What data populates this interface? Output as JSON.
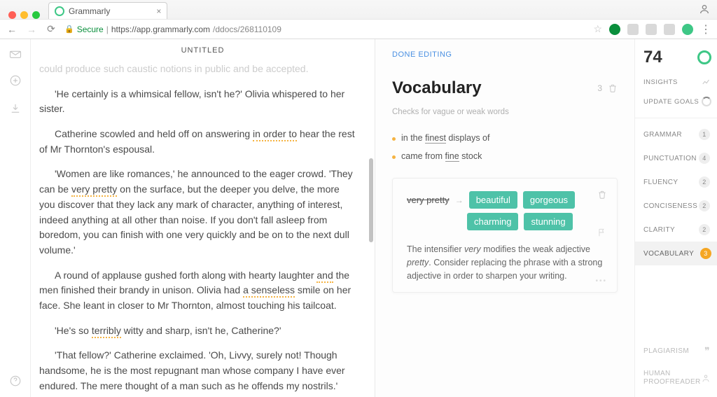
{
  "browser": {
    "tab_title": "Grammarly",
    "secure_label": "Secure",
    "url_scheme_host": "https://app.grammarly.com",
    "url_path": "/ddocs/268110109"
  },
  "document": {
    "title": "UNTITLED",
    "paragraphs": {
      "p0": "could produce such caustic notions in public and be accepted.",
      "p1a": "'He certainly is a whimsical fellow, isn't he?' Olivia whispered to her sister.",
      "p2a": "Catherine scowled and held off on answering ",
      "p2u": "in order to",
      "p2b": " hear the rest of Mr Thornton's espousal.",
      "p3a": "'Women are like romances,' he announced to the eager crowd. 'They can be ",
      "p3u": "very pretty",
      "p3b": " on the surface, but the deeper you delve, the more you discover that they lack any mark of character, anything of interest, indeed anything at all other than noise. If you don't fall asleep from boredom, you can finish with one very quickly and be on to the next dull volume.'",
      "p4a": "A round of applause gushed forth along with hearty laughter ",
      "p4u1": "and",
      "p4b": " the men finished their brandy in unison. Olivia had ",
      "p4u2": "a senseless",
      "p4c": " smile on her face. She leant in closer to Mr Thornton, almost touching his tailcoat.",
      "p5a": "'He's so ",
      "p5u": "terribly",
      "p5b": " witty and sharp, isn't he, Catherine?'",
      "p6": "'That fellow?' Catherine exclaimed. 'Oh, Livvy, surely not! Though handsome, he is the most repugnant man whose company I have ever endured. The mere thought of a man such as he offends my nostrils.'"
    }
  },
  "panel": {
    "done_editing": "DONE EDITING",
    "title": "Vocabulary",
    "count": "3",
    "subtitle": "Checks for vague or weak words",
    "issue1_a": "in the ",
    "issue1_u": "finest",
    "issue1_b": " displays of",
    "issue2_a": "came from ",
    "issue2_u": "fine",
    "issue2_b": " stock",
    "card": {
      "original": "very pretty",
      "suggestions": [
        "beautiful",
        "gorgeous",
        "charming",
        "stunning"
      ],
      "desc1": "The intensifier ",
      "desc_i1": "very",
      "desc2": " modifies the weak adjective ",
      "desc_i2": "pretty",
      "desc3": ". Consider replacing the phrase with a strong adjective in order to sharpen your writing."
    }
  },
  "right_rail": {
    "score": "74",
    "insights": "INSIGHTS",
    "update_goals": "UPDATE GOALS",
    "categories": [
      {
        "label": "GRAMMAR",
        "count": "1"
      },
      {
        "label": "PUNCTUATION",
        "count": "4"
      },
      {
        "label": "FLUENCY",
        "count": "2"
      },
      {
        "label": "CONCISENESS",
        "count": "2"
      },
      {
        "label": "CLARITY",
        "count": "2"
      },
      {
        "label": "VOCABULARY",
        "count": "3"
      }
    ],
    "plagiarism": "PLAGIARISM",
    "human": "HUMAN PROOFREADER"
  }
}
